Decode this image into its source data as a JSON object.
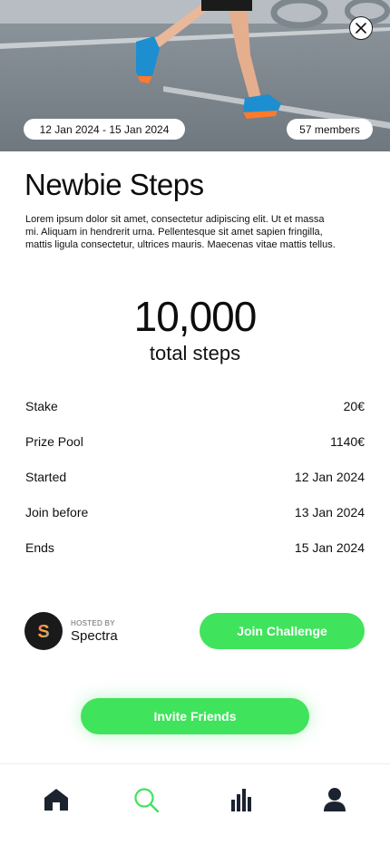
{
  "challenge": {
    "date_range": "12 Jan 2024 - 15 Jan 2024",
    "members": "57 members",
    "title": "Newbie Steps",
    "description": "Lorem ipsum dolor sit amet, consectetur adipiscing elit. Ut et massa mi. Aliquam in hendrerit urna. Pellentesque sit amet sapien fringilla, mattis ligula consectetur, ultrices mauris. Maecenas vitae mattis tellus.",
    "goal_value": "10,000",
    "goal_label": "total steps"
  },
  "details": [
    {
      "label": "Stake",
      "value": "20€"
    },
    {
      "label": "Prize Pool",
      "value": "1140€"
    },
    {
      "label": "Started",
      "value": "12 Jan 2024"
    },
    {
      "label": "Join before",
      "value": "13 Jan 2024"
    },
    {
      "label": "Ends",
      "value": "15 Jan 2024"
    }
  ],
  "host": {
    "caption": "HOSTED BY",
    "name": "Spectra",
    "avatar_letter": "S"
  },
  "buttons": {
    "join": "Join Challenge",
    "invite": "Invite Friends"
  },
  "nav": {
    "items": [
      {
        "icon": "home-icon",
        "active": false
      },
      {
        "icon": "search-icon",
        "active": true
      },
      {
        "icon": "chart-icon",
        "active": false
      },
      {
        "icon": "profile-icon",
        "active": false
      }
    ]
  },
  "colors": {
    "accent": "#40e35c",
    "text": "#111111",
    "nav_icon": "#1c2330"
  }
}
